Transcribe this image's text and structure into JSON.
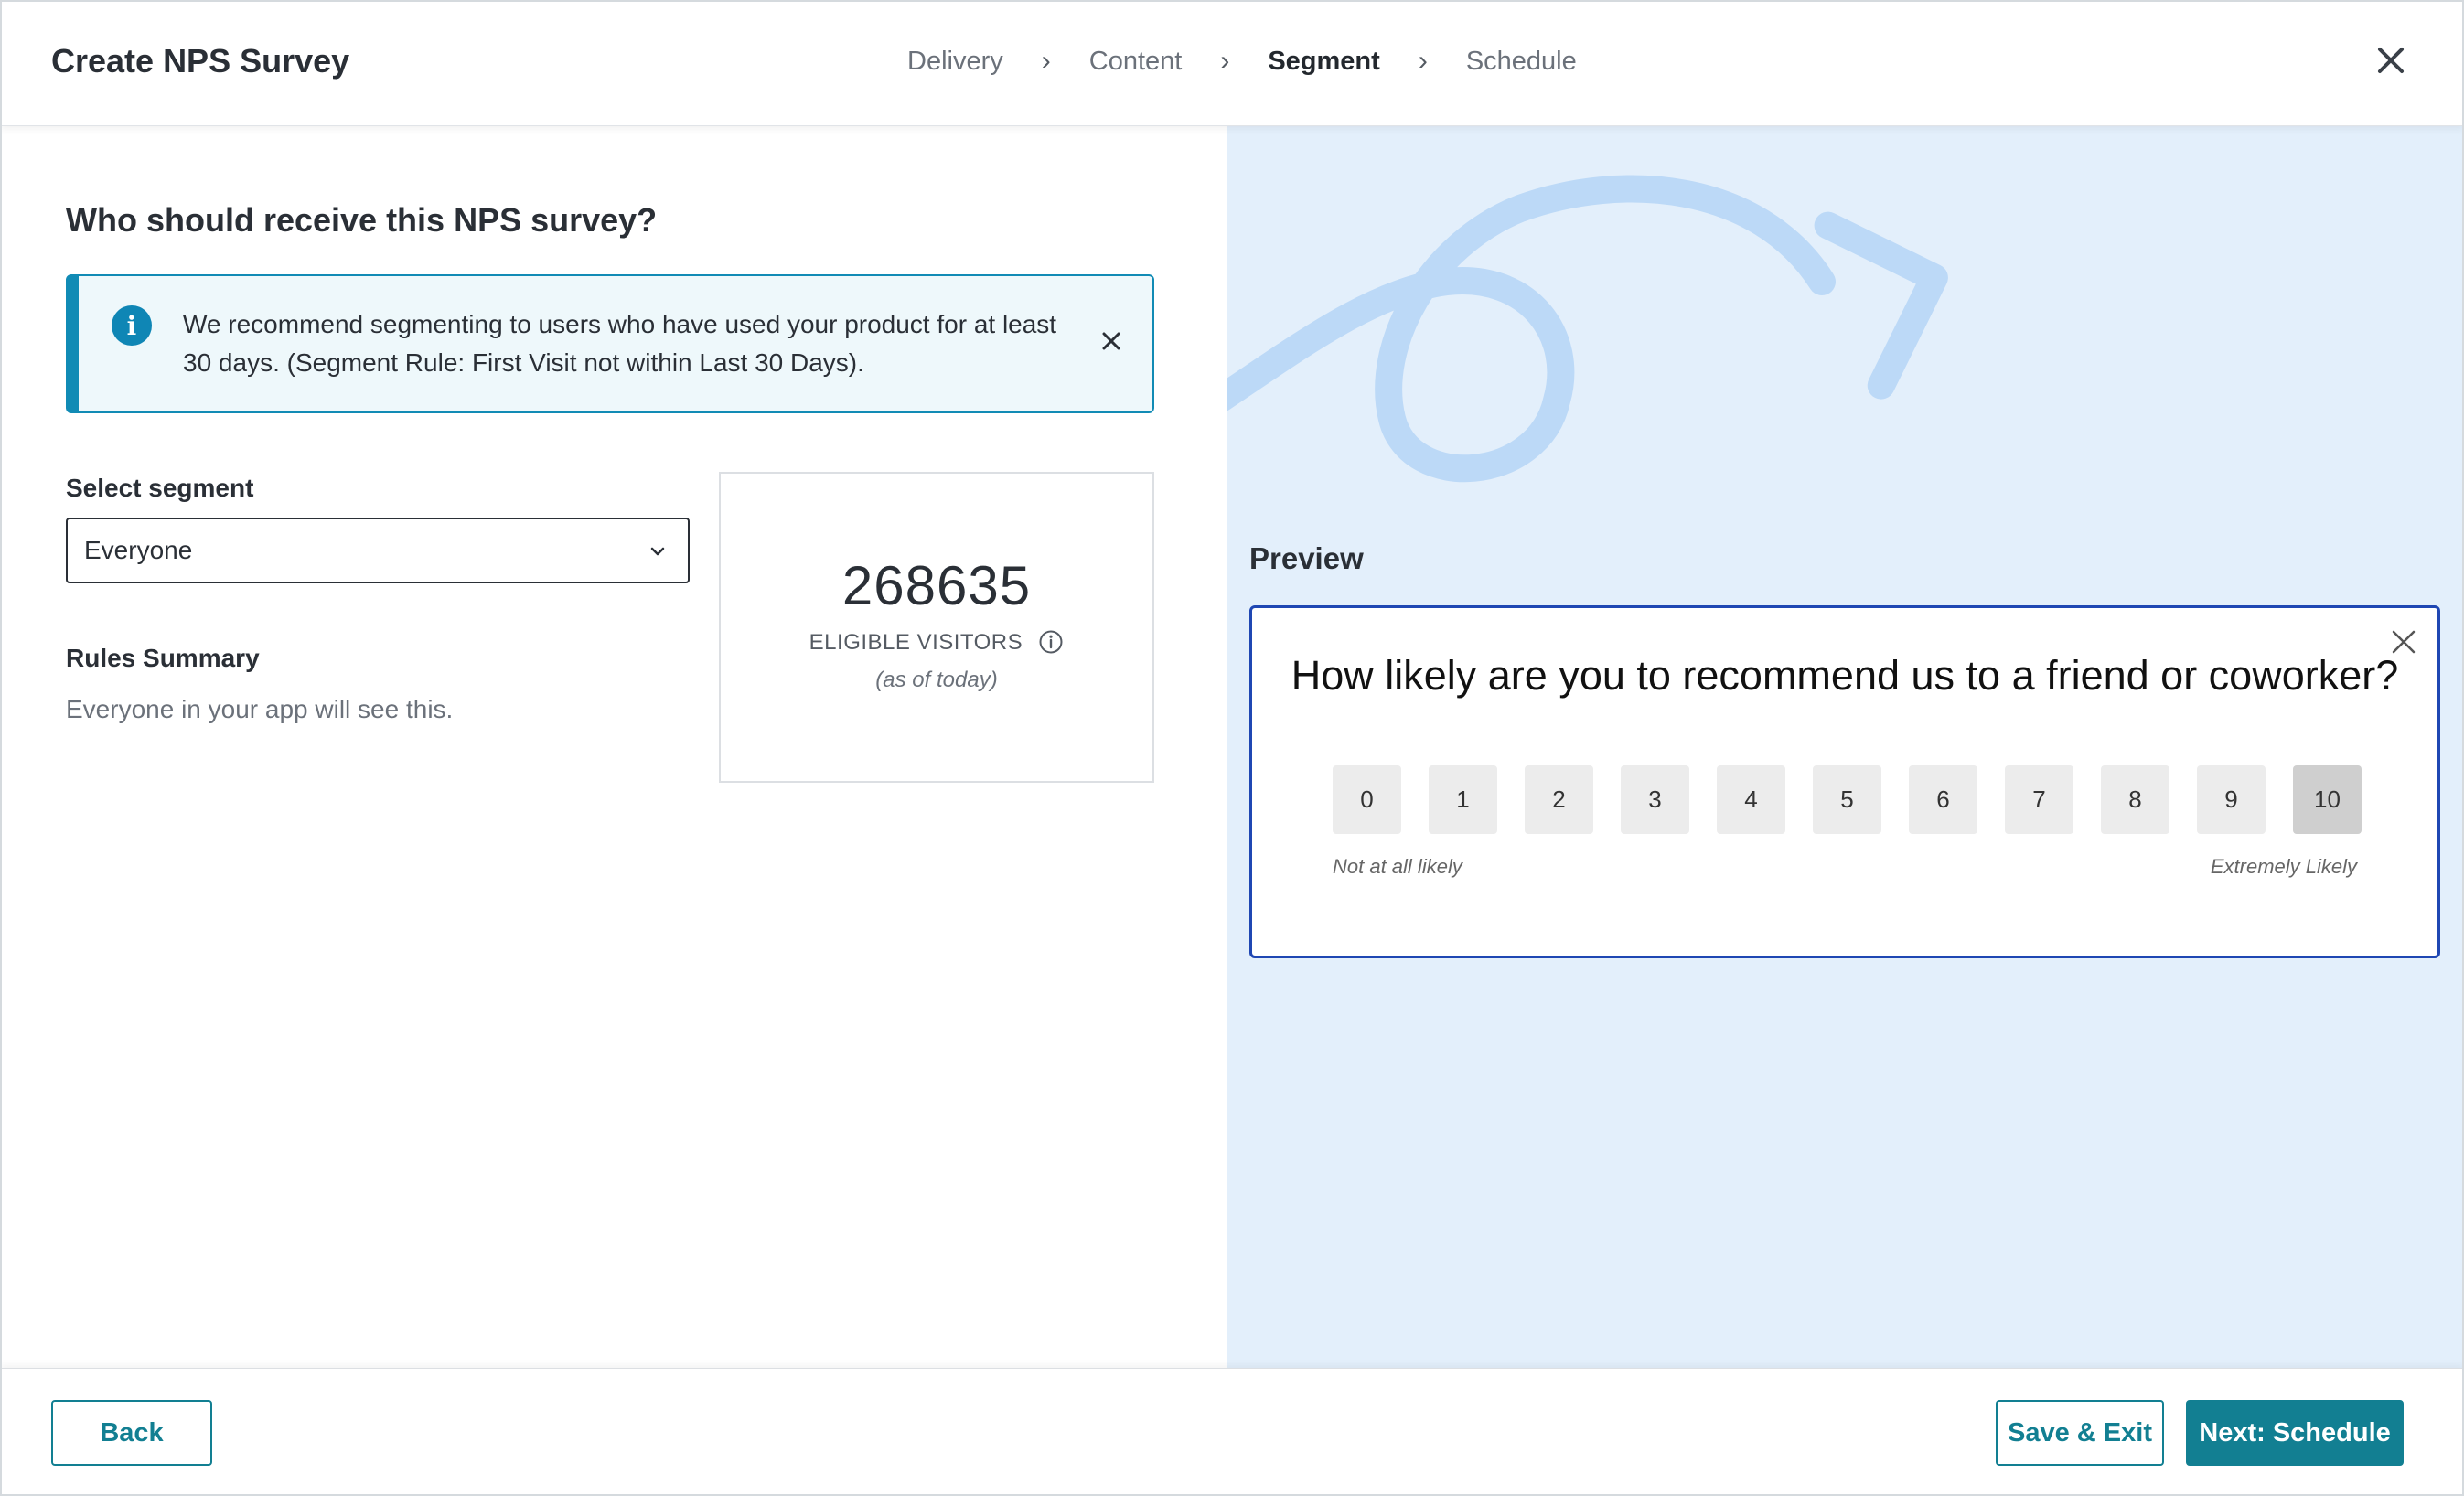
{
  "header": {
    "title": "Create NPS Survey",
    "steps": [
      {
        "label": "Delivery",
        "active": false
      },
      {
        "label": "Content",
        "active": false
      },
      {
        "label": "Segment",
        "active": true
      },
      {
        "label": "Schedule",
        "active": false
      }
    ],
    "close_icon": "close-icon"
  },
  "segment": {
    "heading": "Who should receive this NPS survey?",
    "callout": {
      "icon": "info-icon",
      "text": "We recommend segmenting to users who have used your product for at least 30 days. (Segment Rule: First Visit not within Last 30 Days).",
      "accent": "#118bb5"
    },
    "select_label": "Select segment",
    "selected_value": "Everyone",
    "rules_title": "Rules Summary",
    "rules_text": "Everyone in your app will see this.",
    "visitors": {
      "count": "268635",
      "label": "ELIGIBLE VISITORS",
      "sub": "(as of today)"
    }
  },
  "preview": {
    "label": "Preview",
    "question": "How likely are you to recommend us to a friend or coworker?",
    "scale": [
      "0",
      "1",
      "2",
      "3",
      "4",
      "5",
      "6",
      "7",
      "8",
      "9",
      "10"
    ],
    "selected": "10",
    "low_label": "Not at all likely",
    "high_label": "Extremely Likely",
    "accent": "#1f47b3",
    "background": "#e3effb"
  },
  "footer": {
    "back_label": "Back",
    "save_label": "Save & Exit",
    "next_label": "Next: Schedule",
    "brand_color": "#127f92"
  }
}
